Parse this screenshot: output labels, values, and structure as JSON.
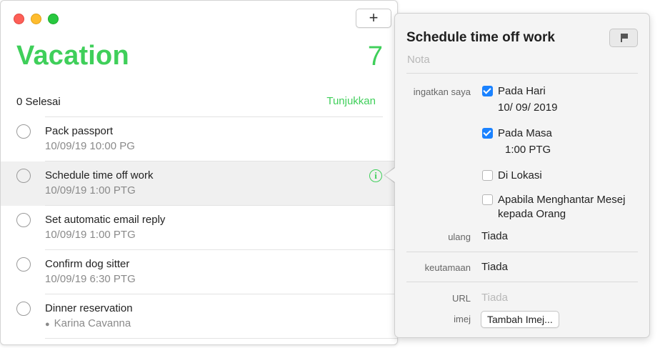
{
  "window": {
    "add_label": "+",
    "list_title": "Vacation",
    "list_count": "7",
    "completed_text": "0 Selesai",
    "show_label": "Tunjukkan"
  },
  "reminders": [
    {
      "title": "Pack passport",
      "subtitle": "10/09/19 10:00 PG"
    },
    {
      "title": "Schedule time off work",
      "subtitle": "10/09/19 1:00 PTG"
    },
    {
      "title": "Set automatic email reply",
      "subtitle": "10/09/19 1:00 PTG"
    },
    {
      "title": "Confirm dog sitter",
      "subtitle": "10/09/19 6:30 PTG"
    },
    {
      "title": "Dinner reservation",
      "subtitle": "Karina Cavanna"
    }
  ],
  "detail": {
    "title": "Schedule time off work",
    "note_placeholder": "Nota",
    "remind_label": "ingatkan saya",
    "on_day_label": "Pada Hari",
    "on_day_value": "10/ 09/ 2019",
    "on_time_label": "Pada Masa",
    "on_time_value": "1:00 PTG",
    "at_location_label": "Di Lokasi",
    "when_messaging_label_1": "Apabila Menghantar Mesej",
    "when_messaging_label_2": "kepada Orang",
    "repeat_label": "ulang",
    "repeat_value": "Tiada",
    "priority_label": "keutamaan",
    "priority_value": "Tiada",
    "url_label": "URL",
    "url_placeholder": "Tiada",
    "image_label": "imej",
    "add_image_label": "Tambah Imej..."
  },
  "colors": {
    "accent_green": "#3fcf5a",
    "checkbox_blue": "#1a82ff"
  }
}
